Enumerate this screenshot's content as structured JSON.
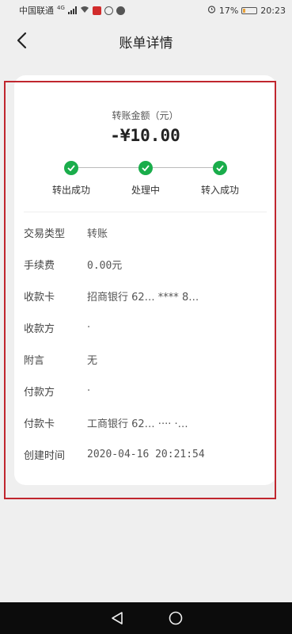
{
  "status_bar": {
    "carrier": "中国联通",
    "network": "4G",
    "battery_text": "17%",
    "battery_level": 0.17,
    "time": "20:23"
  },
  "header": {
    "title": "账单详情",
    "back_icon": "chevron-left-icon"
  },
  "amount": {
    "label": "转账金额（元）",
    "value": "-¥10.00"
  },
  "progress": {
    "accent": "#1aad4b",
    "steps": [
      {
        "label": "转出成功",
        "status": "done"
      },
      {
        "label": "处理中",
        "status": "done"
      },
      {
        "label": "转入成功",
        "status": "done"
      }
    ]
  },
  "details": [
    {
      "key": "交易类型",
      "value": "转账"
    },
    {
      "key": "手续费",
      "value": "0.00元"
    },
    {
      "key": "收款卡",
      "value": "招商银行 62…  ****  8…"
    },
    {
      "key": "收款方",
      "value": "·"
    },
    {
      "key": "附言",
      "value": "无"
    },
    {
      "key": "付款方",
      "value": "·"
    },
    {
      "key": "付款卡",
      "value": "工商银行 62…  ····  ·…"
    },
    {
      "key": "创建时间",
      "value": "2020-04-16 20:21:54"
    }
  ],
  "highlight_color": "#c0262e"
}
